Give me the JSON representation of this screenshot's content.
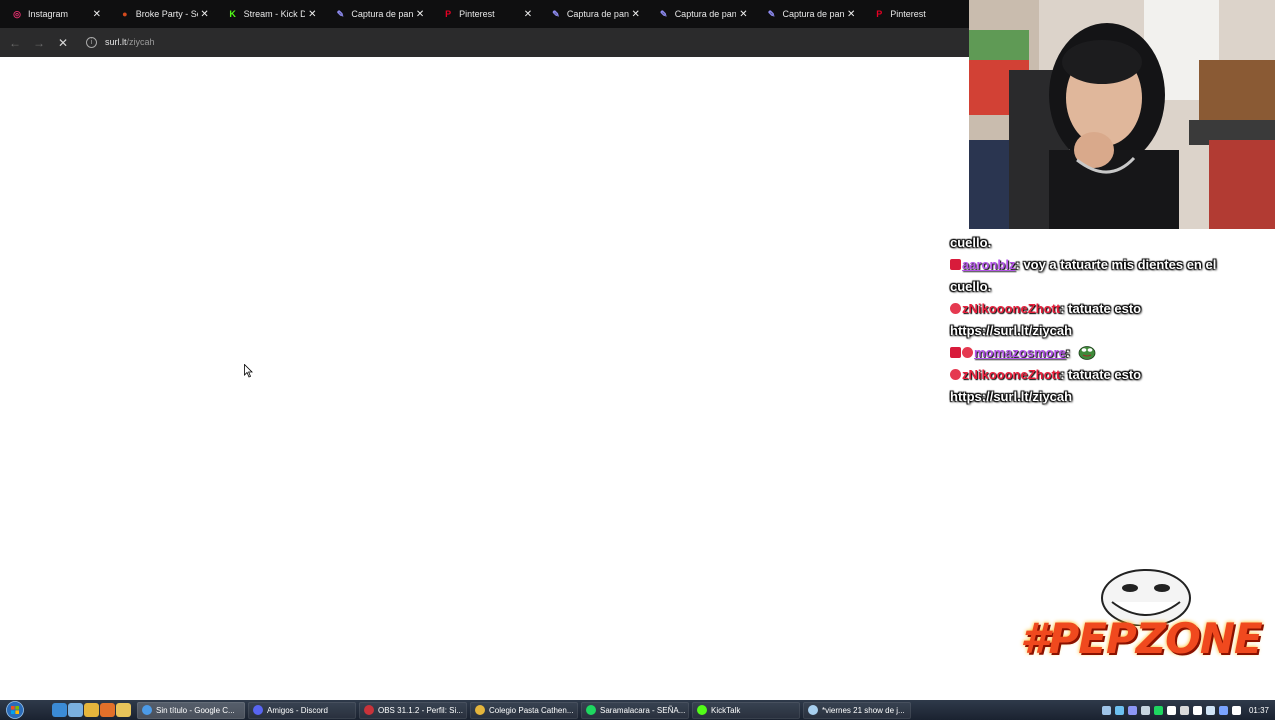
{
  "browser": {
    "tabs": [
      {
        "title": "Instagram",
        "icon": "instagram-icon",
        "color": "#e1306c",
        "glyph": "◎"
      },
      {
        "title": "Broke Party - Segu",
        "icon": "broke-party-icon",
        "color": "#d44a1d",
        "glyph": "●"
      },
      {
        "title": "Stream - Kick Dash",
        "icon": "kick-icon",
        "color": "#53fc18",
        "glyph": "K"
      },
      {
        "title": "Captura de pantalla",
        "icon": "pen-icon",
        "color": "#8f8cf2",
        "glyph": "✎"
      },
      {
        "title": "Pinterest",
        "icon": "pinterest-icon",
        "color": "#e60023",
        "glyph": "P"
      },
      {
        "title": "Captura de pantalla",
        "icon": "pen-icon",
        "color": "#8f8cf2",
        "glyph": "✎"
      },
      {
        "title": "Captura de pantalla",
        "icon": "pen-icon",
        "color": "#8f8cf2",
        "glyph": "✎"
      },
      {
        "title": "Captura de pantalla",
        "icon": "pen-icon",
        "color": "#8f8cf2",
        "glyph": "✎"
      },
      {
        "title": "Pinterest",
        "icon": "pinterest-icon",
        "color": "#e60023",
        "glyph": "P"
      }
    ],
    "close_glyph": "✕",
    "nav": {
      "back": "←",
      "forward": "→",
      "stop": "✕"
    },
    "address": {
      "info_glyph": "i",
      "host": "surl.lt",
      "path": "/ziycah"
    }
  },
  "chat": {
    "lines": [
      {
        "badges": [],
        "user": "",
        "user_style": "",
        "text": "cuello."
      },
      {
        "badges": [
          "mod"
        ],
        "user": "aaronblz",
        "user_style": "u1",
        "text": ": voy a tatuarte mis dientes en el"
      },
      {
        "badges": [],
        "user": "",
        "user_style": "",
        "text": "cuello."
      },
      {
        "badges": [
          "heart"
        ],
        "user": "zNikoooneZhott",
        "user_style": "u2",
        "text": ": tatuate esto"
      },
      {
        "badges": [],
        "user": "",
        "user_style": "",
        "text": "https://surl.lt/ziycah"
      },
      {
        "badges": [
          "mod",
          "heart"
        ],
        "user": "momazosmore",
        "user_style": "u1",
        "text": ": ",
        "emote": true
      },
      {
        "badges": [
          "heart"
        ],
        "user": "zNikoooneZhott",
        "user_style": "u2",
        "text": ": tatuate esto"
      },
      {
        "badges": [],
        "user": "",
        "user_style": "",
        "text": "https://surl.lt/ziycah"
      }
    ]
  },
  "logo": {
    "text": "#PEPZONE"
  },
  "taskbar": {
    "quicklaunch": [
      {
        "icon": "ie-icon",
        "color": "#3b8bd6"
      },
      {
        "icon": "window-icon",
        "color": "#7ab0e0"
      },
      {
        "icon": "chrome-icon",
        "color": "#e5b53c"
      },
      {
        "icon": "firefox-icon",
        "color": "#e2702a"
      },
      {
        "icon": "folder-icon",
        "color": "#e8c45a"
      }
    ],
    "buttons": [
      {
        "label": "Sin título - Google C...",
        "icon": "chrome-icon",
        "color": "#4c9be8",
        "active": true
      },
      {
        "label": "Amigos - Discord",
        "icon": "discord-icon",
        "color": "#5865f2",
        "active": false
      },
      {
        "label": "OBS 31.1.2 - Perfil: Si...",
        "icon": "obs-icon",
        "color": "#c9333a",
        "active": false
      },
      {
        "label": "Colegio Pasta Cathen...",
        "icon": "chrome-icon",
        "color": "#e5b53c",
        "active": false
      },
      {
        "label": "Saramalacara - SEÑA...",
        "icon": "spotify-icon",
        "color": "#1ed760",
        "active": false
      },
      {
        "label": "KickTalk",
        "icon": "kick-icon",
        "color": "#53fc18",
        "active": false
      },
      {
        "label": "*viernes 21 show de j...",
        "icon": "notepad-icon",
        "color": "#a8d0f0",
        "active": false
      }
    ],
    "tray_icons": [
      {
        "icon": "gear-icon",
        "color": "#9fc4e8"
      },
      {
        "icon": "network-icon",
        "color": "#6cc0f0"
      },
      {
        "icon": "discord-tray-icon",
        "color": "#8c96f5"
      },
      {
        "icon": "steam-icon",
        "color": "#c6d4df"
      },
      {
        "icon": "spotify-tray-icon",
        "color": "#1ed760"
      },
      {
        "icon": "mic-icon",
        "color": "#ffffff"
      },
      {
        "icon": "obs-tray-icon",
        "color": "#d9d9d9"
      },
      {
        "icon": "ime-icon",
        "color": "#ffffff"
      },
      {
        "icon": "monitor-icon",
        "color": "#cfe3f5"
      },
      {
        "icon": "chat-tray-icon",
        "color": "#7aa3ff"
      },
      {
        "icon": "volume-icon",
        "color": "#ffffff"
      }
    ],
    "clock": "01:37"
  }
}
